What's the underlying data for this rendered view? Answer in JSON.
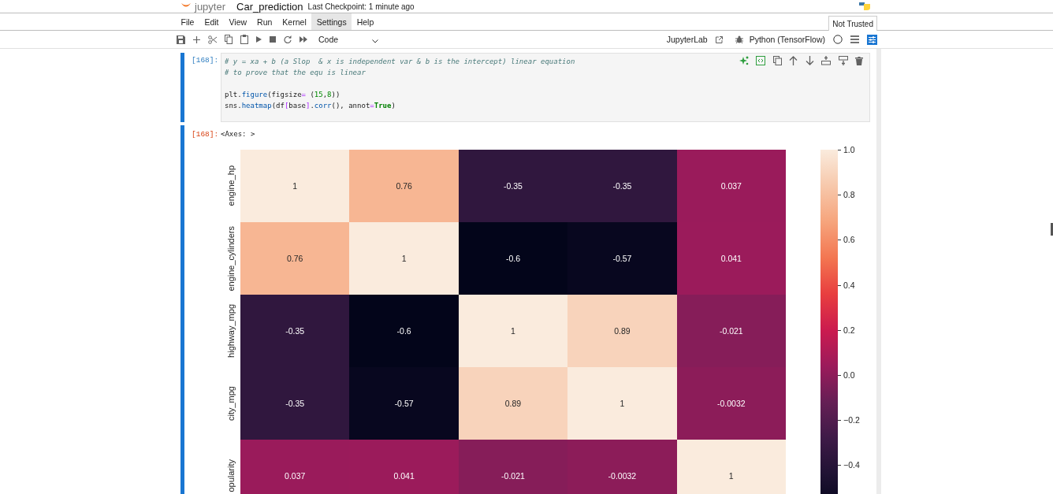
{
  "header": {
    "logo_text": "jupyter",
    "title": "Car_prediction",
    "checkpoint": "Last Checkpoint: 1 minute ago"
  },
  "menu": [
    {
      "label": "File",
      "selected": false
    },
    {
      "label": "Edit",
      "selected": false
    },
    {
      "label": "View",
      "selected": false
    },
    {
      "label": "Run",
      "selected": false
    },
    {
      "label": "Kernel",
      "selected": false
    },
    {
      "label": "Settings",
      "selected": true
    },
    {
      "label": "Help",
      "selected": false
    }
  ],
  "trust_status": "Not Trusted",
  "toolbar": {
    "cell_type": "Code",
    "launcher": "JupyterLab",
    "kernel": "Python (TensorFlow)"
  },
  "input_cell": {
    "prompt": "[168]:",
    "blocks": [
      [
        [
          {
            "kind": "comment",
            "text": "# y = xa + b (a Slop  & x is independent var & b is the intercept) linear equation"
          }
        ],
        [
          {
            "kind": "comment",
            "text": "# to prove that the equ is linear"
          }
        ]
      ],
      [
        [
          {
            "kind": "name",
            "text": "plt"
          },
          {
            "kind": "punct",
            "text": "."
          },
          {
            "kind": "attr",
            "text": "figure"
          },
          {
            "kind": "punct",
            "text": "(figsize"
          },
          {
            "kind": "op",
            "text": "="
          },
          {
            "kind": "punct",
            "text": " ("
          },
          {
            "kind": "number",
            "text": "15"
          },
          {
            "kind": "punct",
            "text": ","
          },
          {
            "kind": "number",
            "text": "8"
          },
          {
            "kind": "punct",
            "text": "))"
          }
        ],
        [
          {
            "kind": "name",
            "text": "sns"
          },
          {
            "kind": "punct",
            "text": "."
          },
          {
            "kind": "attr",
            "text": "heatmap"
          },
          {
            "kind": "punct",
            "text": "(df"
          },
          {
            "kind": "op",
            "text": "["
          },
          {
            "kind": "name",
            "text": "base"
          },
          {
            "kind": "op",
            "text": "]"
          },
          {
            "kind": "punct",
            "text": "."
          },
          {
            "kind": "attr",
            "text": "corr"
          },
          {
            "kind": "punct",
            "text": "(), annot"
          },
          {
            "kind": "op",
            "text": "="
          },
          {
            "kind": "keyword",
            "text": "True"
          },
          {
            "kind": "punct",
            "text": ")"
          }
        ]
      ]
    ]
  },
  "output_cell": {
    "prompt": "[168]:",
    "text": "<Axes: >",
    "heatmap": {
      "rows": [
        {
          "label": "engine_hp",
          "cells": [
            "1",
            "0.76",
            "-0.35",
            "-0.35",
            "0.037"
          ]
        },
        {
          "label": "engine_cylinders",
          "cells": [
            "0.76",
            "1",
            "-0.6",
            "-0.57",
            "0.041"
          ]
        },
        {
          "label": "highway_mpg",
          "cells": [
            "-0.35",
            "-0.6",
            "1",
            "0.89",
            "-0.021"
          ]
        },
        {
          "label": "city_mpg",
          "cells": [
            "-0.35",
            "-0.57",
            "0.89",
            "1",
            "-0.0032"
          ]
        },
        {
          "label": "opularity",
          "cells": [
            "0.037",
            "0.041",
            "-0.021",
            "-0.0032",
            "1"
          ]
        }
      ],
      "colorbar_ticks": [
        "1.0",
        "0.8",
        "0.6",
        "0.4",
        "0.2",
        "0.0",
        "−0.2",
        "−0.4"
      ]
    }
  }
}
